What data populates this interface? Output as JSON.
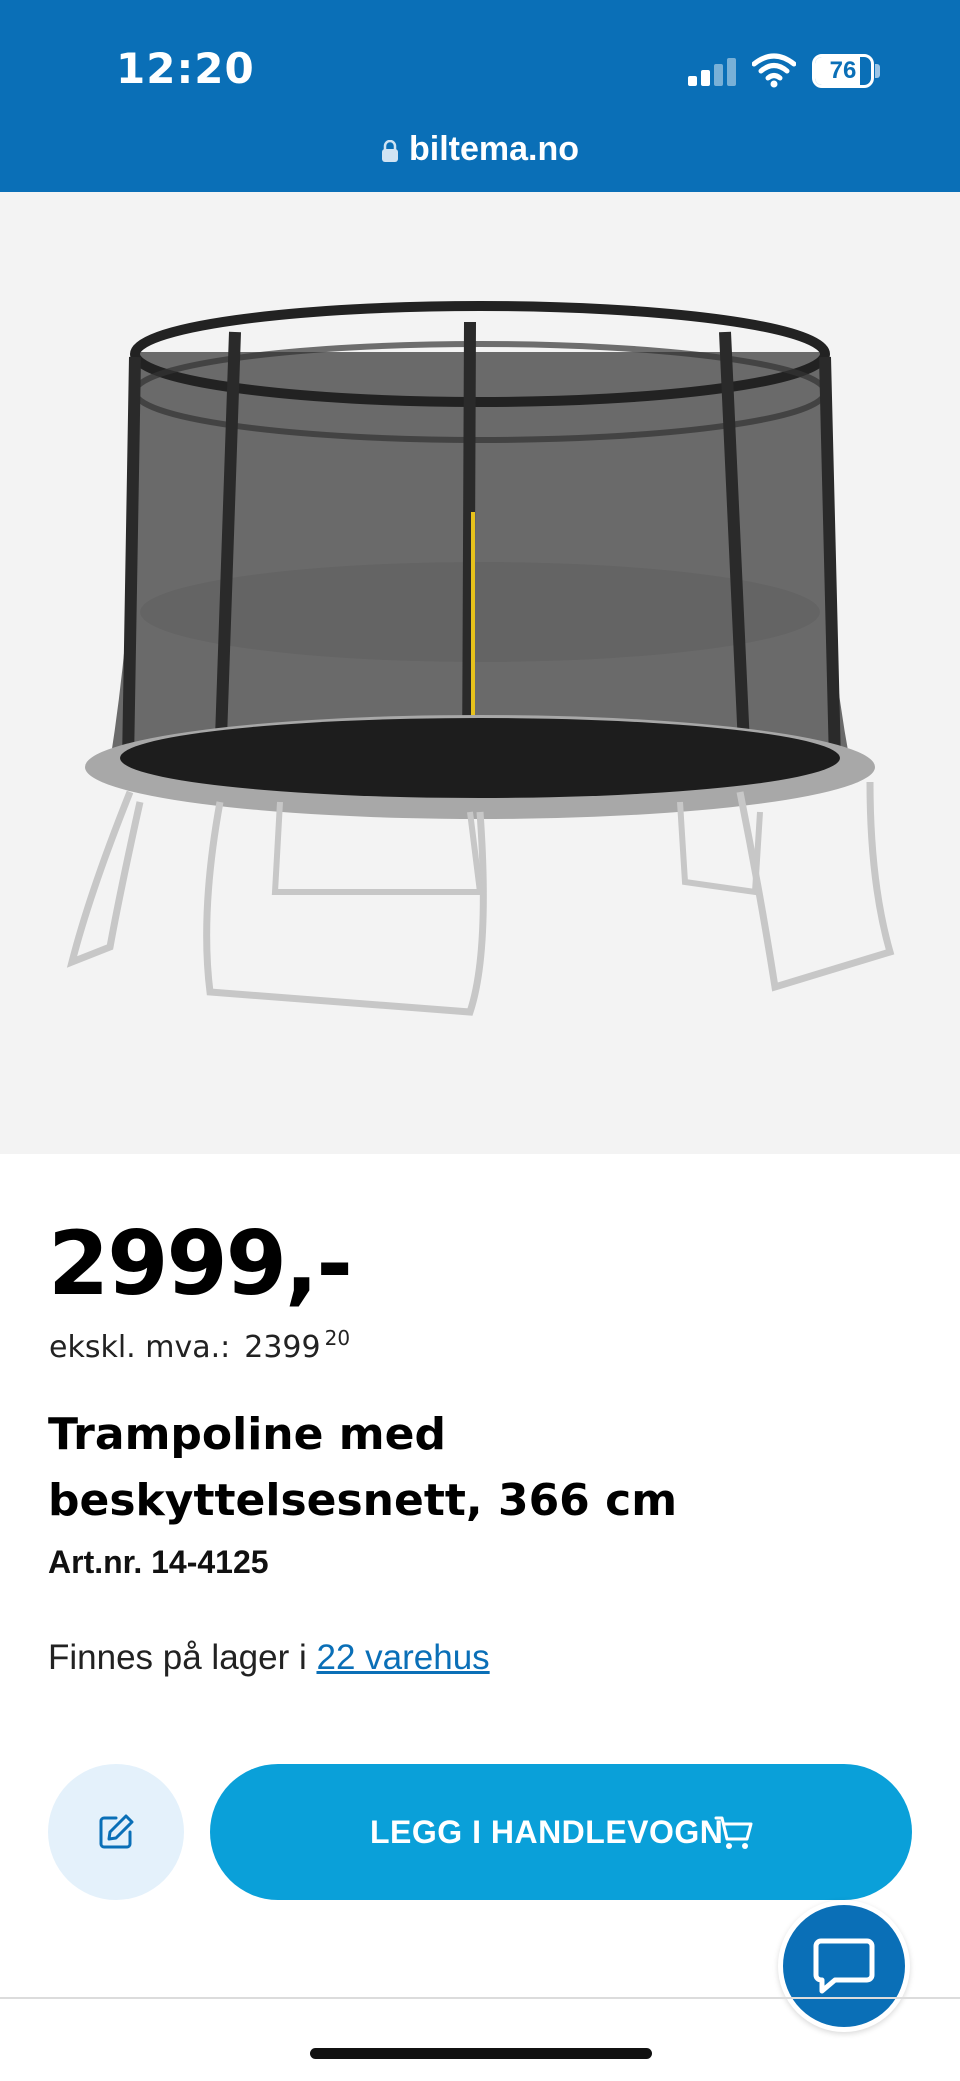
{
  "status_bar": {
    "time": "12:20",
    "battery": "76"
  },
  "browser": {
    "url": "biltema.no"
  },
  "product": {
    "image_icon": "trampoline-image",
    "price": "2999,-",
    "ex_vat_label": "ekskl. mva.:",
    "ex_vat_value": "2399",
    "ex_vat_cents": "20",
    "title": "Trampoline med beskyttelsesnett, 366 cm",
    "art_nr": "Art.nr. 14-4125",
    "stock_prefix": "Finnes på lager i ",
    "stock_link": "22 varehus"
  },
  "actions": {
    "edit_icon": "edit-icon",
    "cart_label": "LEGG I HANDLEVOGN",
    "cart_icon": "cart-icon",
    "chat_icon": "chat-icon"
  },
  "colors": {
    "brand_blue": "#0a6fb7",
    "button_blue": "#0aa0d9"
  }
}
